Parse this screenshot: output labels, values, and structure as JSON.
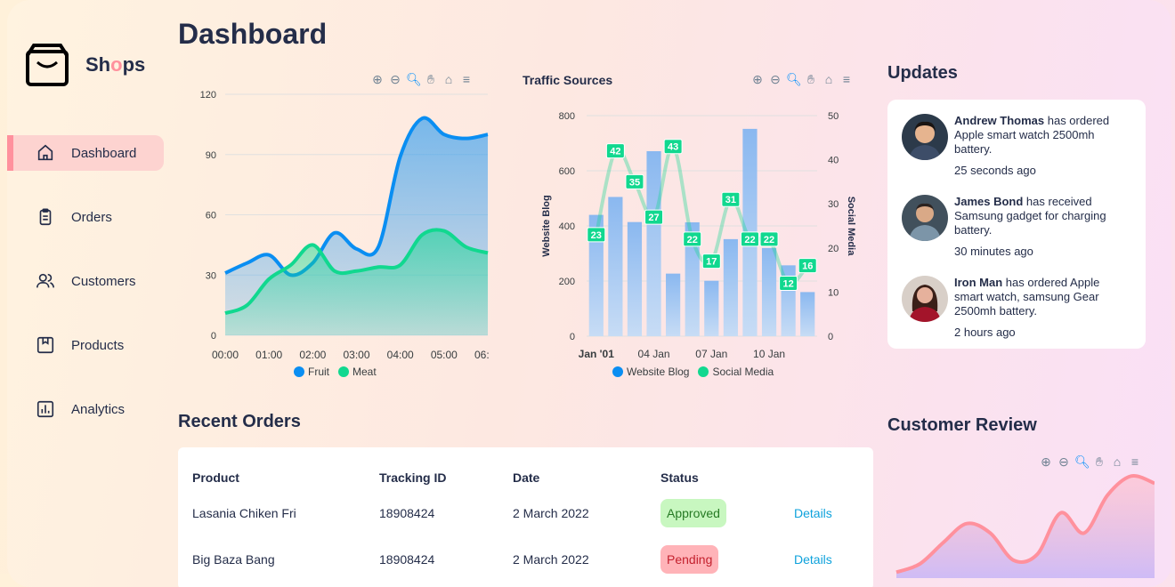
{
  "brand": {
    "prefix": "Sh",
    "highlight": "o",
    "suffix": "ps"
  },
  "page_title": "Dashboard",
  "sidebar": {
    "items": [
      {
        "label": "Dashboard",
        "icon": "home-icon",
        "active": true
      },
      {
        "label": "Orders",
        "icon": "clipboard-icon"
      },
      {
        "label": "Customers",
        "icon": "users-icon"
      },
      {
        "label": "Products",
        "icon": "package-icon"
      },
      {
        "label": "Analytics",
        "icon": "bar-chart-icon"
      }
    ]
  },
  "toolbar_icons": [
    "zoom-in-icon",
    "zoom-out-icon",
    "zoom-select-icon",
    "pan-icon",
    "reset-home-icon",
    "menu-icon"
  ],
  "chart_data": [
    {
      "type": "area",
      "title": "",
      "categories": [
        "00:00",
        "01:00",
        "02:00",
        "03:00",
        "04:00",
        "05:00",
        "06:00"
      ],
      "ylim": [
        0,
        120
      ],
      "yticks": [
        "0",
        "30",
        "60",
        "90",
        "120"
      ],
      "x": [
        0,
        0.5,
        1,
        1.5,
        2,
        2.5,
        3,
        3.5,
        4,
        4.5,
        5,
        5.5,
        6
      ],
      "series": [
        {
          "name": "Fruit",
          "color": "#0a8ef2",
          "values": [
            31,
            36,
            40,
            30,
            36,
            51,
            43,
            44,
            89,
            108,
            100,
            98,
            100
          ]
        },
        {
          "name": "Meat",
          "color": "#11d88f",
          "values": [
            11,
            15,
            28,
            35,
            45,
            32,
            32,
            34,
            35,
            50,
            52,
            44,
            41
          ]
        }
      ],
      "legend": "bottom"
    },
    {
      "type": "bar+line",
      "title": "Traffic Sources",
      "categories": [
        "Jan '01",
        "",
        "",
        "04 Jan",
        "",
        "",
        "07 Jan",
        "",
        "",
        "10 Jan",
        "",
        ""
      ],
      "ylabel": "Website Blog",
      "y2label": "Social Media",
      "ylim": [
        0,
        800
      ],
      "y2lim": [
        0,
        50
      ],
      "yticks": [
        "0",
        "200",
        "400",
        "600",
        "800"
      ],
      "y2ticks": [
        "0",
        "10",
        "20",
        "30",
        "40",
        "50"
      ],
      "series": [
        {
          "name": "Website Blog",
          "color": "#96bff0",
          "type": "bar",
          "values": [
            440,
            505,
            414,
            671,
            227,
            413,
            201,
            352,
            752,
            320,
            257,
            160
          ]
        },
        {
          "name": "Social Media",
          "color": "#11d88f",
          "type": "line",
          "values": [
            23,
            42,
            35,
            27,
            43,
            22,
            17,
            31,
            22,
            22,
            12,
            16
          ]
        }
      ],
      "legend": "bottom"
    },
    {
      "type": "area",
      "title": "",
      "values": [
        5,
        12,
        30,
        46,
        38,
        15,
        20,
        55,
        38,
        70,
        86,
        80
      ],
      "colors": {
        "line": "#ff919d",
        "fill": "#d8c7f7"
      }
    }
  ],
  "recent_orders": {
    "title": "Recent Orders",
    "columns": [
      "Product",
      "Tracking ID",
      "Date",
      "Status",
      ""
    ],
    "rows": [
      {
        "product": "Lasania Chiken Fri",
        "tracking": "18908424",
        "date": "2 March 2022",
        "status": "Approved",
        "action": "Details"
      },
      {
        "product": "Big Baza Bang",
        "tracking": "18908424",
        "date": "2 March 2022",
        "status": "Pending",
        "action": "Details"
      }
    ]
  },
  "updates": {
    "title": "Updates",
    "items": [
      {
        "name": "Andrew Thomas",
        "text": " has ordered Apple smart watch 2500mh battery.",
        "time": "25 seconds ago"
      },
      {
        "name": "James Bond",
        "text": " has received Samsung gadget for charging battery.",
        "time": "30 minutes ago"
      },
      {
        "name": "Iron Man",
        "text": " has ordered Apple smart watch, samsung Gear 2500mh battery.",
        "time": "2 hours ago"
      }
    ]
  },
  "customer_review": {
    "title": "Customer Review"
  }
}
